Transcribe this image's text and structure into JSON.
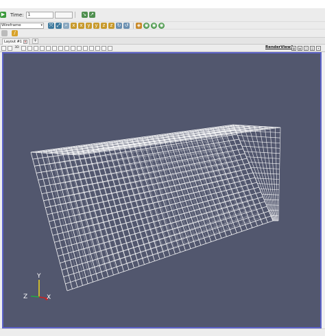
{
  "toolbar": {
    "time_label": "Time:",
    "time_value": "1",
    "representation_value": "Wireframe"
  },
  "tabs": {
    "layout_tab_label": "Layout #1",
    "tab_close_glyph": "×",
    "new_tab_glyph": "+"
  },
  "view": {
    "view_name": "RenderView1",
    "toolbar_3d_label": "3D"
  },
  "axes": {
    "x_label": "X",
    "y_label": "Y",
    "z_label": "Z"
  },
  "colors": {
    "background": "#52576e",
    "active_view_border": "#5c62c9",
    "wireframe": "#ffffff",
    "axis_x": "#cc2222",
    "axis_y": "#e8d020",
    "axis_z": "#22aa44"
  },
  "icons": {
    "representation_dropdown": "chevron-down-icon",
    "ruler_tool": "ruler-icon"
  }
}
